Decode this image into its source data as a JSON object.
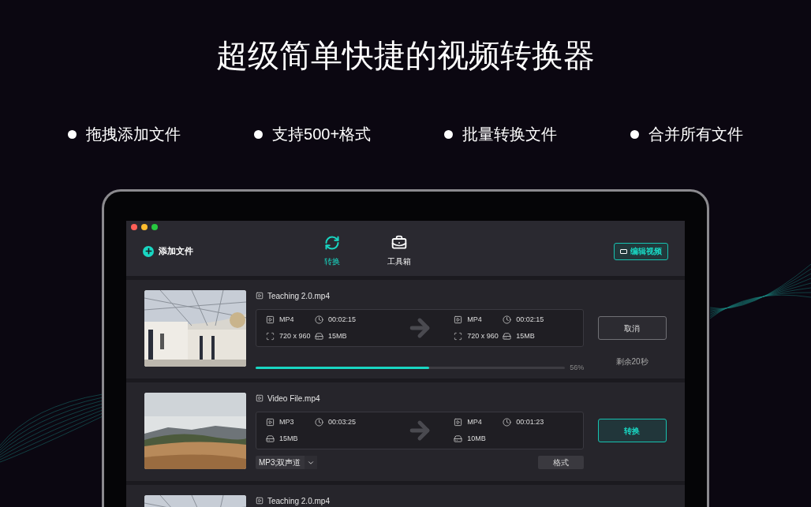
{
  "headline": "超级简单快捷的视频转换器",
  "features": [
    "拖拽添加文件",
    "支持500+格式",
    "批量转换文件",
    "合并所有文件"
  ],
  "app": {
    "add_button": "添加文件",
    "tabs": [
      {
        "label": "转换",
        "kind": "convert",
        "selected": true
      },
      {
        "label": "工具箱",
        "kind": "toolbox",
        "selected": false
      }
    ],
    "edit_button": "编辑视频",
    "files": [
      {
        "name": "Teaching 2.0.mp4",
        "source": [
          {
            "kind": "format",
            "text": "MP4"
          },
          {
            "kind": "duration",
            "text": "00:02:15"
          },
          {
            "kind": "resolution",
            "text": "720 x 960"
          },
          {
            "kind": "size",
            "text": "15MB"
          }
        ],
        "target": [
          {
            "kind": "format",
            "text": "MP4"
          },
          {
            "kind": "duration",
            "text": "00:02:15"
          },
          {
            "kind": "resolution",
            "text": "720 x 960"
          },
          {
            "kind": "size",
            "text": "15MB"
          }
        ],
        "action": {
          "kind": "cancel",
          "label": "取消"
        },
        "progress": {
          "level": 0.56,
          "percent": "56%",
          "remaining": "剩余20秒"
        }
      },
      {
        "name": "Video File.mp4",
        "source": [
          {
            "kind": "format",
            "text": "MP3"
          },
          {
            "kind": "duration",
            "text": "00:03:25"
          },
          {
            "kind": "size",
            "text": "15MB"
          }
        ],
        "target": [
          {
            "kind": "format",
            "text": "MP4"
          },
          {
            "kind": "duration",
            "text": "00:01:23"
          },
          {
            "kind": "size",
            "text": "10MB"
          }
        ],
        "action": {
          "kind": "convert",
          "label": "转换"
        },
        "options": {
          "value": "MP3;双声道",
          "format_button": "格式"
        }
      },
      {
        "name": "Teaching 2.0.mp4"
      }
    ]
  }
}
